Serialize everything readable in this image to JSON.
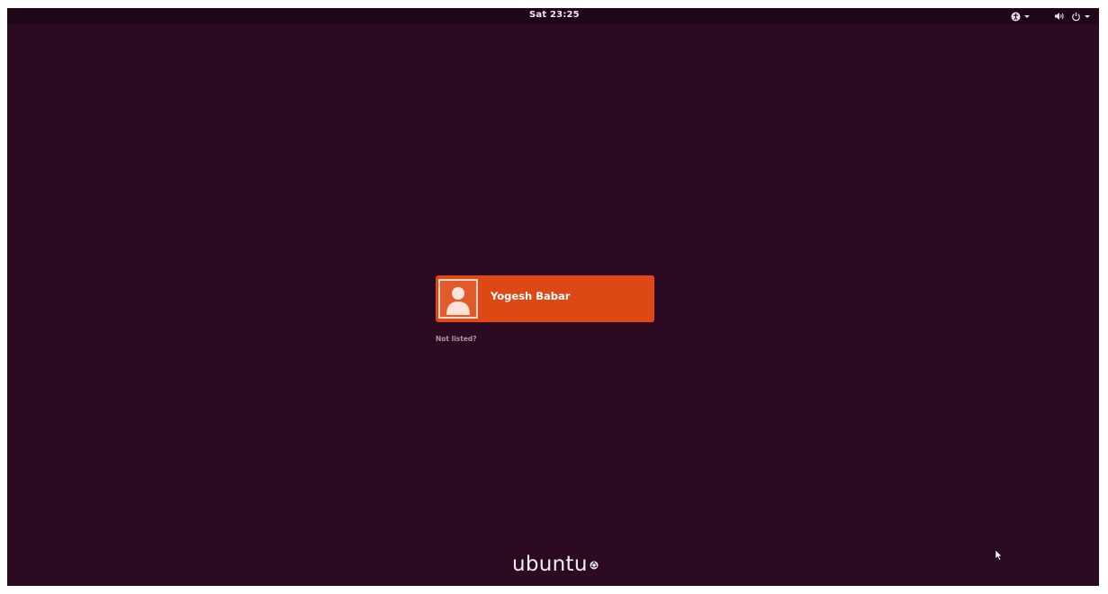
{
  "top_bar": {
    "clock": "Sat 23:25",
    "icons": [
      "accessibility-icon",
      "volume-icon",
      "power-icon"
    ]
  },
  "user_list": {
    "users": [
      {
        "name": "Yogesh Babar",
        "avatar": "default-user-avatar"
      }
    ],
    "not_listed_label": "Not listed?"
  },
  "branding": {
    "logo_text": "ubuntu",
    "logo_icon": "circle-of-friends-icon"
  },
  "colors": {
    "background": "#2c0a21",
    "top_bar": "#1f0619",
    "accent": "#dd4814"
  }
}
